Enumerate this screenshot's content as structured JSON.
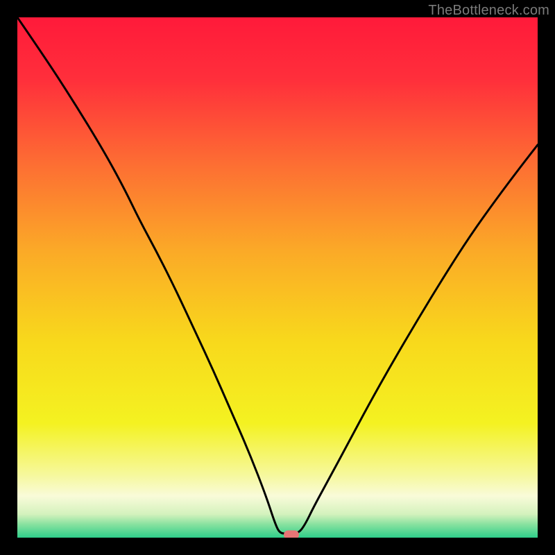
{
  "watermark": "TheBottleneck.com",
  "marker": {
    "x_frac": 0.527,
    "y_frac": 0.995
  },
  "gradient_stops": [
    {
      "offset": 0.0,
      "color": "#ff1a3a"
    },
    {
      "offset": 0.12,
      "color": "#ff2f3b"
    },
    {
      "offset": 0.28,
      "color": "#fd6d33"
    },
    {
      "offset": 0.45,
      "color": "#fbaa27"
    },
    {
      "offset": 0.62,
      "color": "#f8d81c"
    },
    {
      "offset": 0.78,
      "color": "#f4f221"
    },
    {
      "offset": 0.88,
      "color": "#f6f89d"
    },
    {
      "offset": 0.92,
      "color": "#f9fbd9"
    },
    {
      "offset": 0.955,
      "color": "#d4f2bd"
    },
    {
      "offset": 0.975,
      "color": "#86e19f"
    },
    {
      "offset": 1.0,
      "color": "#2fce8a"
    }
  ],
  "curve": [
    {
      "x": 0.0,
      "y": 0.0
    },
    {
      "x": 0.055,
      "y": 0.08
    },
    {
      "x": 0.11,
      "y": 0.165
    },
    {
      "x": 0.165,
      "y": 0.255
    },
    {
      "x": 0.205,
      "y": 0.328
    },
    {
      "x": 0.235,
      "y": 0.39
    },
    {
      "x": 0.27,
      "y": 0.455
    },
    {
      "x": 0.305,
      "y": 0.525
    },
    {
      "x": 0.34,
      "y": 0.6
    },
    {
      "x": 0.375,
      "y": 0.675
    },
    {
      "x": 0.41,
      "y": 0.755
    },
    {
      "x": 0.445,
      "y": 0.835
    },
    {
      "x": 0.478,
      "y": 0.92
    },
    {
      "x": 0.496,
      "y": 0.975
    },
    {
      "x": 0.505,
      "y": 0.992
    },
    {
      "x": 0.52,
      "y": 0.992
    },
    {
      "x": 0.54,
      "y": 0.992
    },
    {
      "x": 0.553,
      "y": 0.975
    },
    {
      "x": 0.57,
      "y": 0.94
    },
    {
      "x": 0.6,
      "y": 0.885
    },
    {
      "x": 0.635,
      "y": 0.82
    },
    {
      "x": 0.675,
      "y": 0.745
    },
    {
      "x": 0.72,
      "y": 0.665
    },
    {
      "x": 0.77,
      "y": 0.58
    },
    {
      "x": 0.82,
      "y": 0.498
    },
    {
      "x": 0.87,
      "y": 0.42
    },
    {
      "x": 0.92,
      "y": 0.35
    },
    {
      "x": 0.965,
      "y": 0.29
    },
    {
      "x": 1.0,
      "y": 0.245
    }
  ],
  "chart_data": {
    "type": "line",
    "title": "",
    "xlabel": "",
    "ylabel": "",
    "xlim": [
      0,
      1
    ],
    "ylim": [
      0,
      1
    ],
    "series": [
      {
        "name": "bottleneck-curve",
        "x": [
          0.0,
          0.055,
          0.11,
          0.165,
          0.205,
          0.235,
          0.27,
          0.305,
          0.34,
          0.375,
          0.41,
          0.445,
          0.478,
          0.496,
          0.505,
          0.52,
          0.54,
          0.553,
          0.57,
          0.6,
          0.635,
          0.675,
          0.72,
          0.77,
          0.82,
          0.87,
          0.92,
          0.965,
          1.0
        ],
        "y": [
          1.0,
          0.92,
          0.835,
          0.745,
          0.672,
          0.61,
          0.545,
          0.475,
          0.4,
          0.325,
          0.245,
          0.165,
          0.08,
          0.025,
          0.008,
          0.008,
          0.008,
          0.025,
          0.06,
          0.115,
          0.18,
          0.255,
          0.335,
          0.42,
          0.502,
          0.58,
          0.65,
          0.71,
          0.755
        ]
      }
    ],
    "annotations": [
      {
        "type": "marker",
        "x": 0.527,
        "y": 0.005,
        "label": "optimal-point"
      }
    ],
    "background": "vertical-gradient red→orange→yellow→pale→green",
    "grid": false,
    "legend": false
  }
}
